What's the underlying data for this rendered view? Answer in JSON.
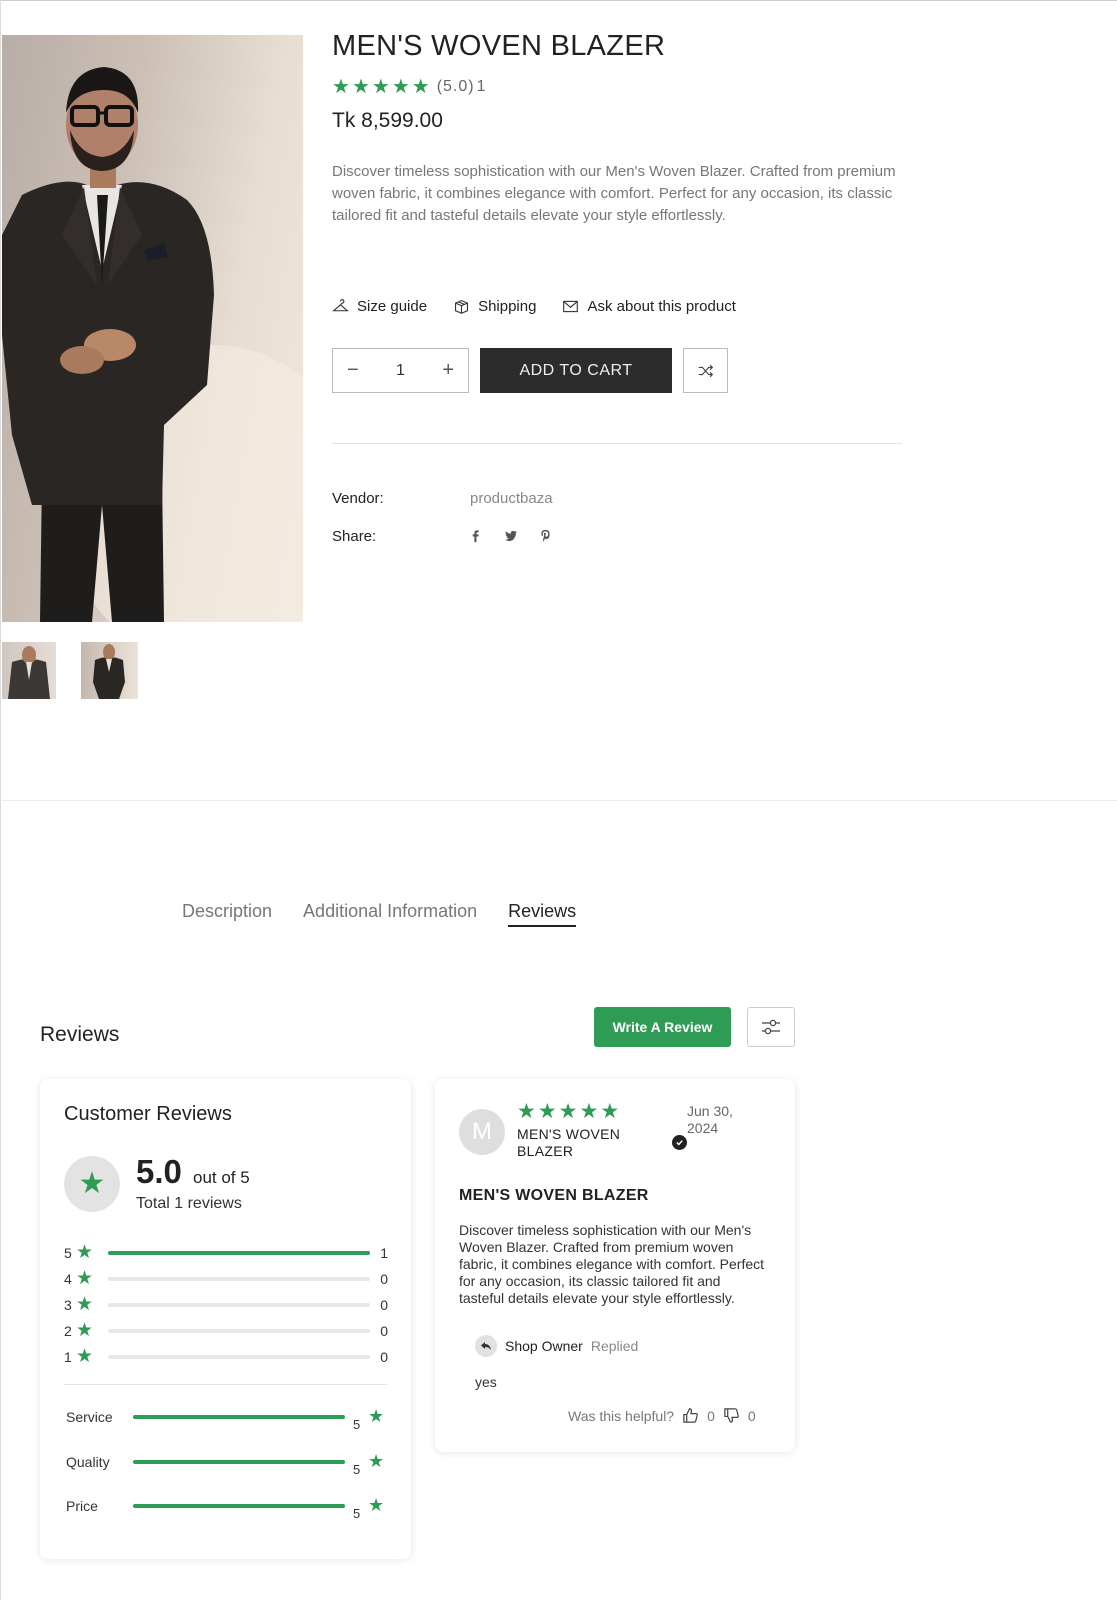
{
  "product": {
    "title": "MEN'S WOVEN BLAZER",
    "rating_text": "(5.0)",
    "rating_count": "1",
    "price": "Tk 8,599.00",
    "description": "Discover timeless sophistication with our Men's Woven Blazer. Crafted from premium woven fabric, it combines elegance with comfort. Perfect for any occasion, its classic tailored fit and tasteful details elevate your style effortlessly.",
    "links": {
      "size_guide": "Size guide",
      "shipping": "Shipping",
      "ask": "Ask about this product"
    },
    "quantity": "1",
    "add_to_cart": "ADD TO CART",
    "vendor_label": "Vendor:",
    "vendor_value": "productbaza",
    "share_label": "Share:"
  },
  "tabs": [
    {
      "label": "Description"
    },
    {
      "label": "Additional Information"
    },
    {
      "label": "Reviews"
    }
  ],
  "reviews": {
    "section_title": "Reviews",
    "write_button": "Write A Review",
    "summary": {
      "title": "Customer Reviews",
      "average": "5.0",
      "out_of": "out of 5",
      "total": "Total 1 reviews",
      "distribution": [
        {
          "stars": "5",
          "count": "1",
          "fraction": 1.0
        },
        {
          "stars": "4",
          "count": "0",
          "fraction": 0
        },
        {
          "stars": "3",
          "count": "0",
          "fraction": 0
        },
        {
          "stars": "2",
          "count": "0",
          "fraction": 0
        },
        {
          "stars": "1",
          "count": "0",
          "fraction": 0
        }
      ],
      "categories": [
        {
          "label": "Service",
          "value": "5"
        },
        {
          "label": "Quality",
          "value": "5"
        },
        {
          "label": "Price",
          "value": "5"
        }
      ]
    },
    "review": {
      "avatar_letter": "M",
      "product": "MEN'S WOVEN BLAZER",
      "date": "Jun 30, 2024",
      "title": "MEN'S WOVEN BLAZER",
      "body": "Discover timeless sophistication with our Men's Woven Blazer. Crafted from premium woven fabric, it combines elegance with comfort. Perfect for any occasion, its classic tailored fit and tasteful details elevate your style effortlessly.",
      "reply_author": "Shop Owner",
      "reply_status": "Replied",
      "reply_text": "yes",
      "helpful_label": "Was this helpful?",
      "likes": "0",
      "dislikes": "0"
    }
  },
  "colors": {
    "accent_green": "#2e9c55",
    "button_dark": "#2c2c2c"
  },
  "icons": [
    "star-icon",
    "hanger-icon",
    "box-icon",
    "mail-icon",
    "minus-icon",
    "plus-icon",
    "shuffle-icon",
    "facebook-icon",
    "twitter-icon",
    "pinterest-icon",
    "filter-icon",
    "verified-icon",
    "reply-icon",
    "thumbs-up-icon",
    "thumbs-down-icon"
  ]
}
